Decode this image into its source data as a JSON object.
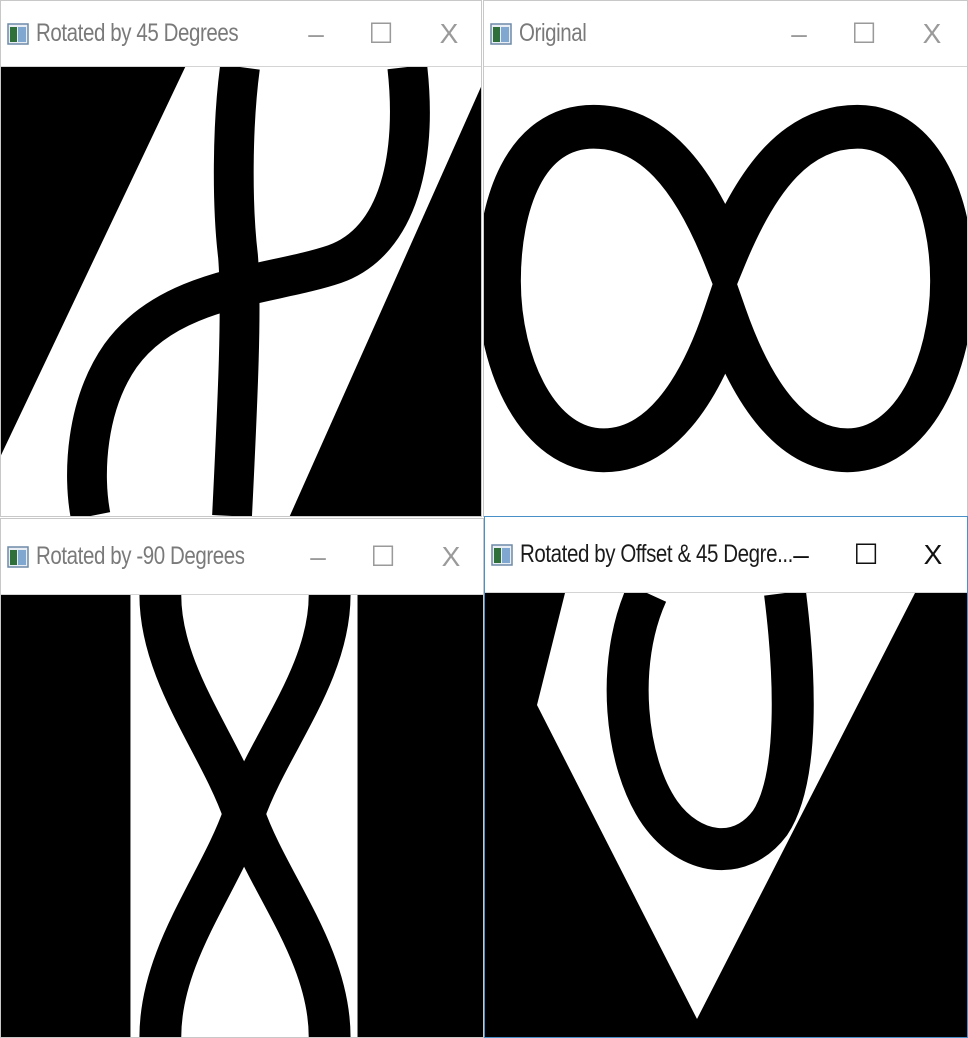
{
  "windows": [
    {
      "title": "Rotated by 45 Degrees",
      "state": "inactive",
      "minimize": "–",
      "maximize": "☐",
      "close": "X"
    },
    {
      "title": "Original",
      "state": "inactive",
      "minimize": "–",
      "maximize": "☐",
      "close": "X"
    },
    {
      "title": "Rotated by -90 Degrees",
      "state": "inactive",
      "minimize": "–",
      "maximize": "☐",
      "close": "X"
    },
    {
      "title": "Rotated by Offset & 45 Degre...",
      "state": "active",
      "minimize": "–",
      "maximize": "☐",
      "close": "X"
    }
  ],
  "icons": {
    "app": "opencv-window-icon"
  },
  "colors": {
    "active_border": "#4a90c8",
    "image_black": "#000000",
    "image_white": "#ffffff"
  }
}
